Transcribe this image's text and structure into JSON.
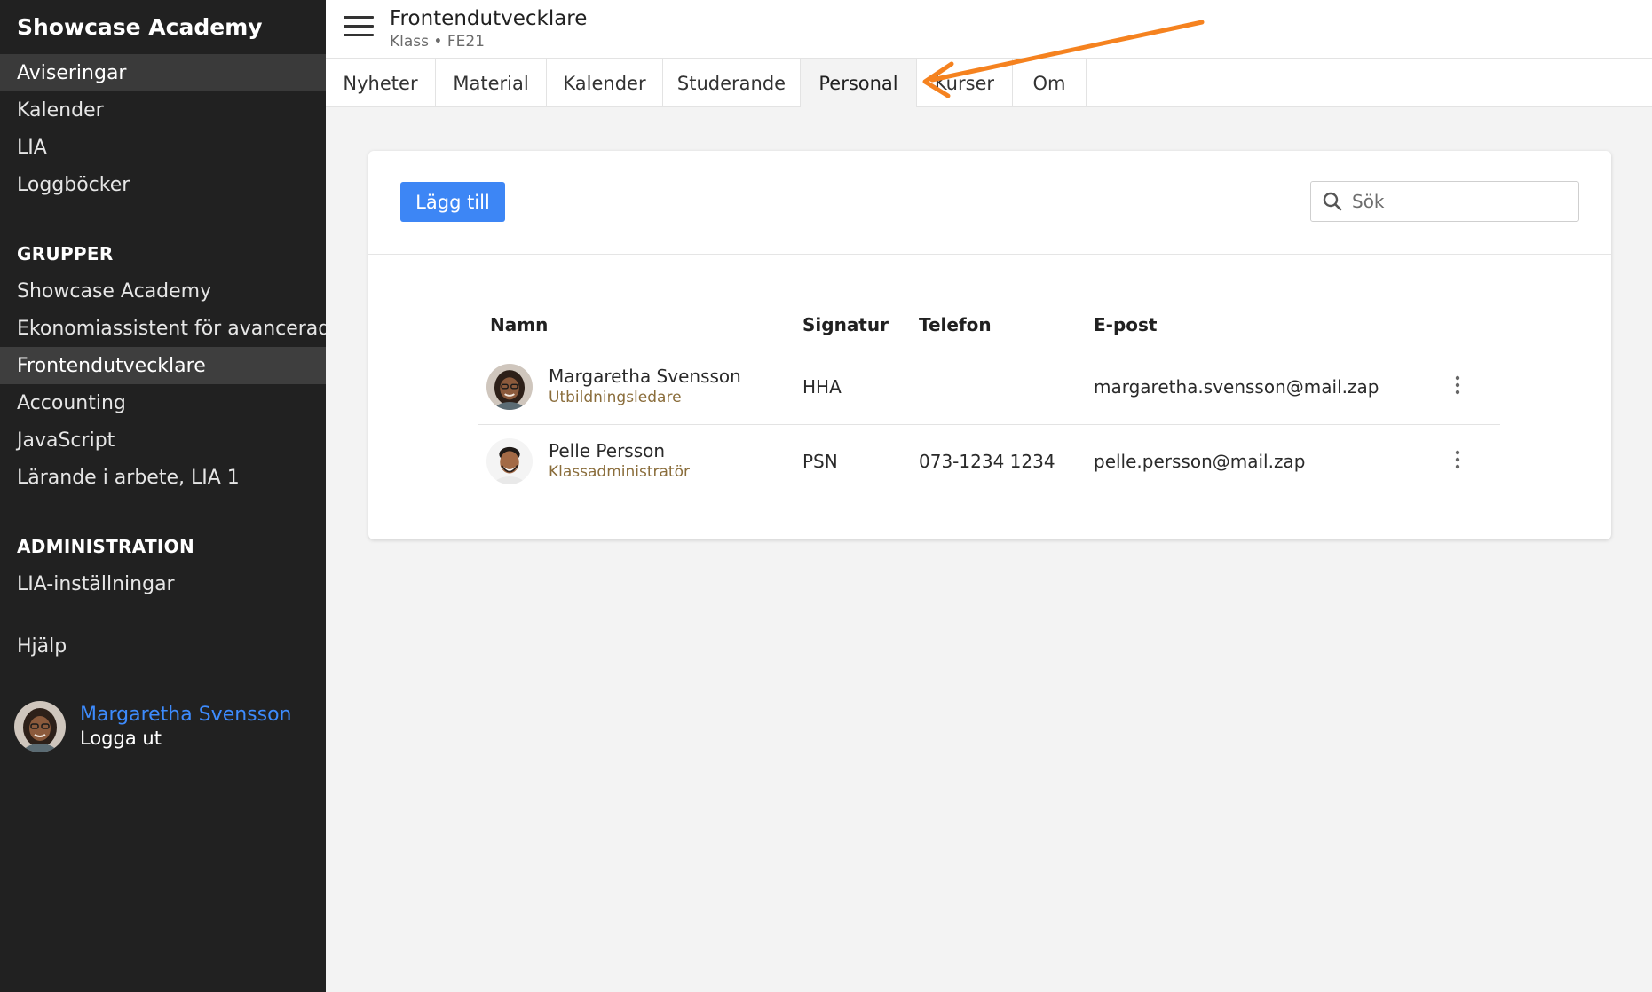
{
  "sidebar": {
    "brand": "Showcase Academy",
    "top_items": [
      {
        "label": "Aviseringar"
      },
      {
        "label": "Kalender"
      },
      {
        "label": "LIA"
      },
      {
        "label": "Loggböcker"
      }
    ],
    "groups_title": "GRUPPER",
    "groups": [
      {
        "label": "Showcase Academy"
      },
      {
        "label": "Ekonomiassistent för avancerad..."
      },
      {
        "label": "Frontendutvecklare"
      },
      {
        "label": "Accounting"
      },
      {
        "label": "JavaScript"
      },
      {
        "label": "Lärande i arbete, LIA 1"
      }
    ],
    "admin_title": "ADMINISTRATION",
    "admin_items": [
      {
        "label": "LIA-inställningar"
      }
    ],
    "help": "Hjälp",
    "user": {
      "name": "Margaretha Svensson",
      "logout": "Logga ut"
    }
  },
  "header": {
    "title": "Frontendutvecklare",
    "subtitle": "Klass  •  FE21"
  },
  "tabs": [
    {
      "label": "Nyheter"
    },
    {
      "label": "Material"
    },
    {
      "label": "Kalender"
    },
    {
      "label": "Studerande"
    },
    {
      "label": "Personal"
    },
    {
      "label": "Kurser"
    },
    {
      "label": "Om"
    }
  ],
  "active_tab": "Personal",
  "toolbar": {
    "add_label": "Lägg till",
    "search_placeholder": "Sök"
  },
  "table": {
    "columns": [
      "Namn",
      "Signatur",
      "Telefon",
      "E-post"
    ],
    "rows": [
      {
        "name": "Margaretha Svensson",
        "role": "Utbildningsledare",
        "signature": "HHA",
        "phone": "",
        "email": "margaretha.svensson@mail.zap"
      },
      {
        "name": "Pelle Persson",
        "role": "Klassadministratör",
        "signature": "PSN",
        "phone": "073-1234 1234",
        "email": "pelle.persson@mail.zap"
      }
    ]
  },
  "colors": {
    "accent": "#3d86f5",
    "link": "#3d8bfd",
    "annotation_arrow": "#f5821f",
    "sidebar_bg": "#212121"
  }
}
